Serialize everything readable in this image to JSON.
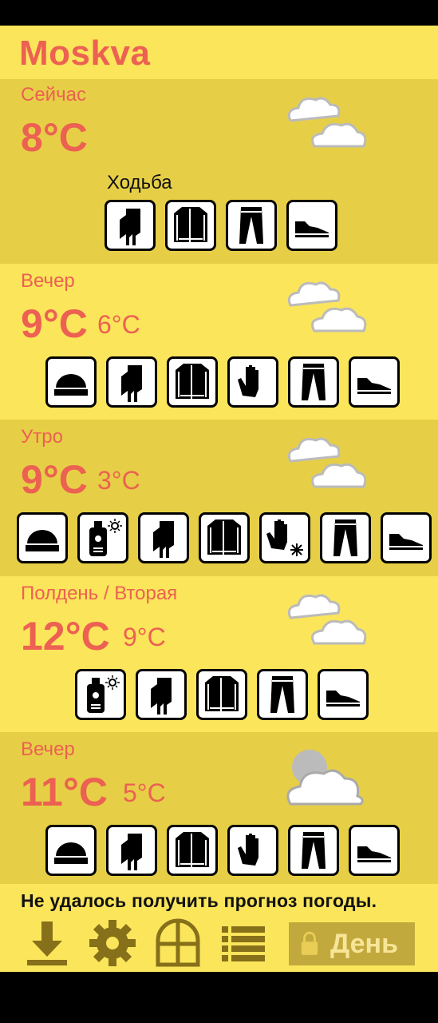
{
  "city": "Moskva",
  "sections": [
    {
      "label": "Сейчас",
      "temp": "8°C",
      "temp_low": "",
      "activity": "Ходьба",
      "weather": "cloudy-icon",
      "icons": [
        "scarf-icon",
        "jacket-icon",
        "trousers-icon",
        "sneaker-icon"
      ]
    },
    {
      "label": "Вечер",
      "temp": "9°C",
      "temp_low": "6°C",
      "weather": "cloudy-icon",
      "icons": [
        "hat-icon",
        "scarf-icon",
        "jacket-icon",
        "gloves-icon",
        "trousers-icon",
        "sneaker-icon"
      ]
    },
    {
      "label": "Утро",
      "temp": "9°C",
      "temp_low": "3°C",
      "weather": "cloudy-icon",
      "icons": [
        "hat-icon",
        "sunscreen-icon",
        "scarf-icon",
        "jacket-icon",
        "winter-gloves-icon",
        "trousers-icon",
        "sneaker-icon"
      ]
    },
    {
      "label": "Полдень / Вторая",
      "temp": "12°C",
      "temp_low": "9°C",
      "weather": "cloudy-icon",
      "icons": [
        "sunscreen-icon",
        "scarf-icon",
        "jacket-icon",
        "trousers-icon",
        "sneaker-icon"
      ]
    },
    {
      "label": "Вечер",
      "temp": "11°C",
      "temp_low": "5°C",
      "weather": "night-cloudy-icon",
      "icons": [
        "hat-icon",
        "scarf-icon",
        "jacket-icon",
        "gloves-icon",
        "trousers-icon",
        "sneaker-icon"
      ]
    }
  ],
  "error_message": "Не удалось получить прогноз погоды.",
  "toolbar": {
    "icons": [
      "download-icon",
      "settings-gear-icon",
      "window-icon",
      "list-icon"
    ],
    "day_button_label": "День",
    "day_button_icon": "lock-icon"
  },
  "colors": {
    "background": "#fbe55b",
    "section_alt": "#e6cf46",
    "accent_text": "#ec6152",
    "toolbar_icon": "#867019",
    "day_button": "#c2a93d"
  }
}
